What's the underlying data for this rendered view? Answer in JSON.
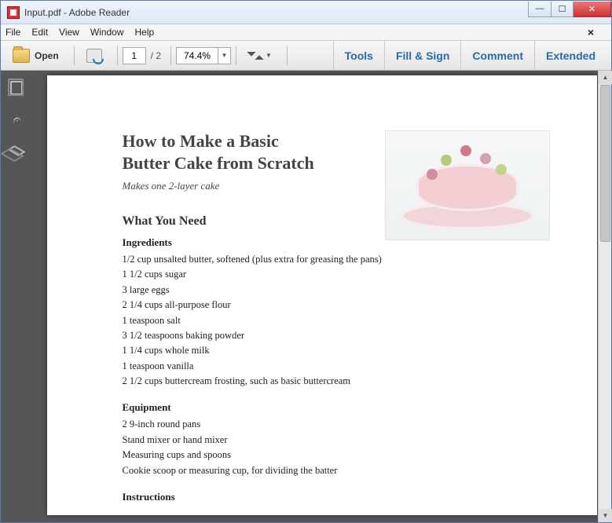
{
  "window": {
    "title": "Input.pdf - Adobe Reader"
  },
  "menu": {
    "items": [
      "File",
      "Edit",
      "View",
      "Window",
      "Help"
    ]
  },
  "toolbar": {
    "open_label": "Open",
    "page_current": "1",
    "page_total": "/ 2",
    "zoom": "74.4%",
    "right_buttons": [
      "Tools",
      "Fill & Sign",
      "Comment",
      "Extended"
    ]
  },
  "document": {
    "title": "How to Make a Basic Butter Cake from Scratch",
    "subtitle": "Makes one 2-layer cake",
    "section1": "What You Need",
    "ingredients_heading": "Ingredients",
    "ingredients": [
      "1/2 cup unsalted butter, softened (plus extra for greasing the pans)",
      "1 1/2 cups sugar",
      "3 large eggs",
      "2 1/4 cups all-purpose flour",
      "1 teaspoon salt",
      "3 1/2 teaspoons baking powder",
      "1 1/4 cups whole milk",
      "1 teaspoon vanilla",
      "2 1/2 cups buttercream frosting, such as basic buttercream"
    ],
    "equipment_heading": "Equipment",
    "equipment": [
      "2 9-inch round pans",
      "Stand mixer or hand mixer",
      "Measuring cups and spoons",
      "Cookie scoop or measuring cup, for dividing the batter"
    ],
    "instructions_heading": "Instructions"
  }
}
